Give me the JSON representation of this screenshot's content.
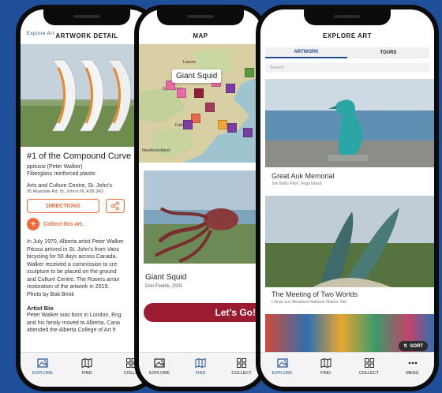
{
  "detail": {
    "back_label": "Explore Art",
    "header": "ARTWORK DETAIL",
    "title": "#1 of the Compound Curve",
    "artist": "ppitussi (Peter Walker)",
    "material": "Fiberglass reinforced plastic",
    "venue": "Arts and Culture Centre, St. John's",
    "address": "95 Allandale Rd. St. John's NL A1B 3A3",
    "directions_label": "DIRECTIONS",
    "collect_label": "Collect this art.",
    "description": [
      "In July 1970, Alberta artist Peter Walker",
      "Pitussi arrived in St. John's from Vanc",
      "bicycling for 50 days across Canada.",
      "Walker received a commission to cre",
      "sculpture to be placed on the ground",
      "and Culture Centre. The Rooms arran",
      "restoration of the artwork in 2019.",
      "Photo by Bob Brink"
    ],
    "bio_heading": "Artist Bio",
    "bio": [
      "Peter Walker was born in London, Eng",
      "and his family moved to Alberta, Cana",
      "attended the Alberta College of Art fr"
    ]
  },
  "map": {
    "header": "MAP",
    "callout": "Giant Squid",
    "labels": [
      "Lascie",
      "Springdale",
      "Falls",
      "Newfoundland"
    ],
    "card_title": "Giant Squid",
    "card_subtitle": "Don Foulds, 2001",
    "go_label": "Let's Go!"
  },
  "explore": {
    "header": "EXPLORE ART",
    "tab_artwork": "ARTWORK",
    "tab_tours": "TOURS",
    "search_placeholder": "Search",
    "items": [
      {
        "title": "Great Auk Memorial",
        "subtitle": "Joe Batt's Point, Fogo Island"
      },
      {
        "title": "The Meeting of Two Worlds",
        "subtitle": "L'Anse aux Meadows National Historic Site"
      }
    ],
    "sort_label": "SORT"
  },
  "tabs": {
    "explore": "EXPLORE",
    "find": "FIND",
    "collect": "COLLECT",
    "collect_cut": "COLLE",
    "menu": "MENU"
  },
  "colors": {
    "accent": "#ef6b3a",
    "brand": "#1f4f98",
    "go": "#9b1b30"
  }
}
